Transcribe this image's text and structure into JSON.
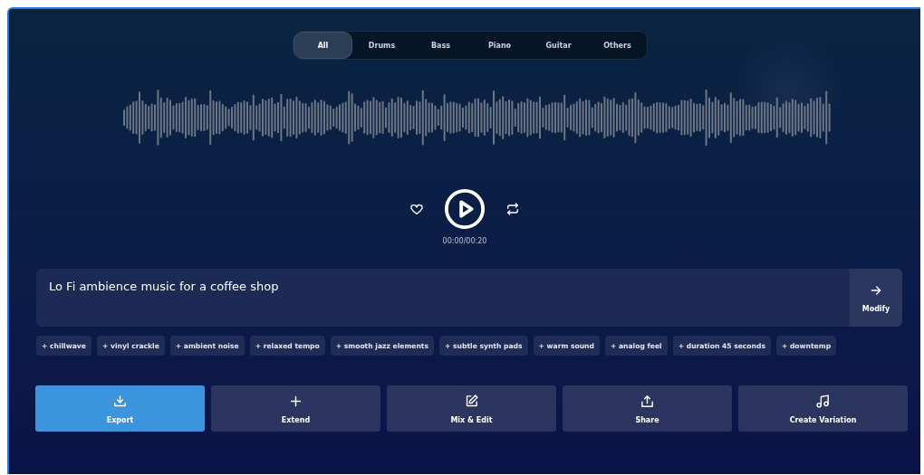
{
  "tabs": [
    {
      "label": "All",
      "selected": true
    },
    {
      "label": "Drums",
      "selected": false
    },
    {
      "label": "Bass",
      "selected": false
    },
    {
      "label": "Piano",
      "selected": false
    },
    {
      "label": "Guitar",
      "selected": false
    },
    {
      "label": "Others",
      "selected": false
    }
  ],
  "player": {
    "time": "00:00/00:20"
  },
  "prompt": {
    "value": "Lo Fi ambience music for a coffee shop",
    "button": "Modify"
  },
  "suggestions": [
    "+ chillwave",
    "+ vinyl crackle",
    "+ ambient noise",
    "+ relaxed tempo",
    "+ smooth jazz elements",
    "+ subtle synth pads",
    "+ warm sound",
    "+ analog feel",
    "+ duration 45 seconds",
    "+ downtemp"
  ],
  "actions": [
    {
      "label": "Export",
      "kind": "download",
      "selected": true
    },
    {
      "label": "Extend",
      "kind": "extend",
      "selected": false
    },
    {
      "label": "Mix & Edit",
      "kind": "edit",
      "selected": false
    },
    {
      "label": "Share",
      "kind": "share",
      "selected": false
    },
    {
      "label": "Create Variation",
      "kind": "variation",
      "selected": false
    }
  ]
}
